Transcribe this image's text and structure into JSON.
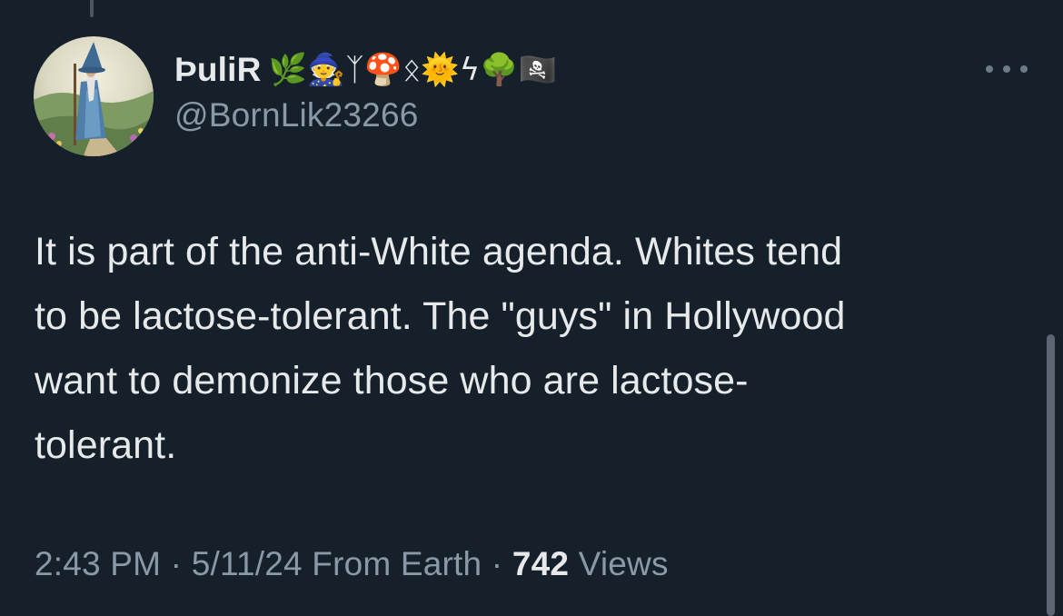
{
  "author": {
    "display_name": "ÞuliR",
    "emoji_badges": "🌿🧙ᛉ🍄ᛟ🌞ϟ🌳🏴‍☠️",
    "handle": "@BornLik23266"
  },
  "tweet": {
    "text": "It is part of the anti-White agenda. Whites tend\nto be lactose-tolerant. The \"guys\" in Hollywood\nwant to demonize those who are lactose-\ntolerant."
  },
  "meta": {
    "time": "2:43 PM",
    "sep1": " · ",
    "date": "5/11/24",
    "location": " From Earth",
    "sep2": " · ",
    "views_count": "742",
    "views_label": " Views"
  },
  "icons": {
    "more": "more-horizontal-icon",
    "avatar": "wizard-avatar"
  },
  "colors": {
    "background": "#15202b",
    "text_primary": "#e7e9ea",
    "text_secondary": "#8b98a5"
  }
}
